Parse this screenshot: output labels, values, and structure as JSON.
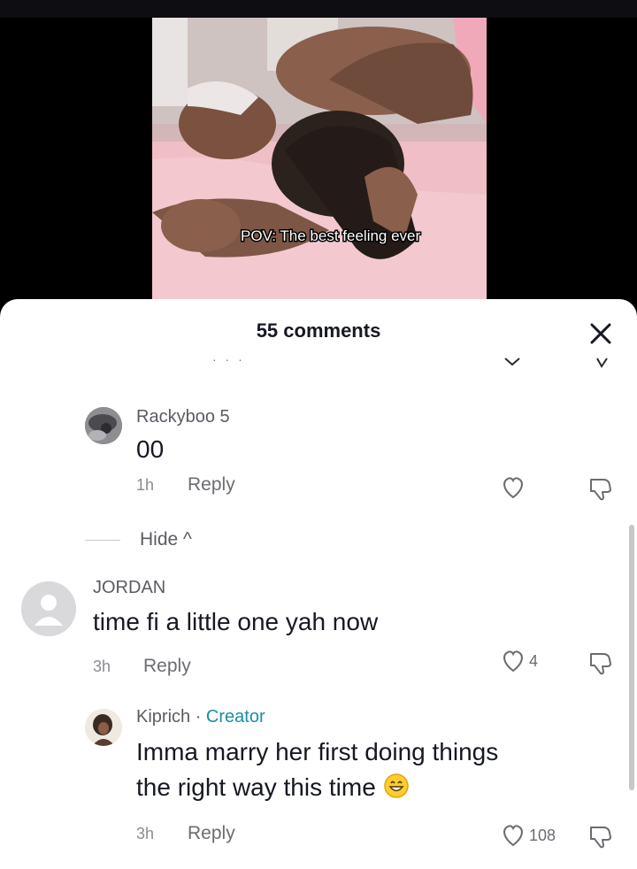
{
  "video": {
    "caption": "POV: The best feeling ever"
  },
  "comments_sheet": {
    "title": "55 comments",
    "comments": [
      {
        "username": "Rackyboo 5",
        "text": "00",
        "time": "1h",
        "reply_label": "Reply"
      },
      {
        "username": "JORDAN",
        "text": "time fi a little one yah now",
        "time": "3h",
        "reply_label": "Reply",
        "likes": "4"
      },
      {
        "username": "Kiprich",
        "creator_separator": " · ",
        "creator_badge": "Creator",
        "text_line1": "Imma marry her first doing things",
        "text_line2": "the right way this time",
        "time": "3h",
        "reply_label": "Reply",
        "likes": "108"
      }
    ],
    "hide_label": "Hide ^"
  },
  "colors": {
    "creator": "#1a8fa4",
    "sheet_bg": "#ffffff",
    "text": "#161823"
  },
  "icons": [
    "close-icon",
    "heart-icon",
    "dislike-icon",
    "chevron-down-icon",
    "grin-emoji-icon"
  ]
}
